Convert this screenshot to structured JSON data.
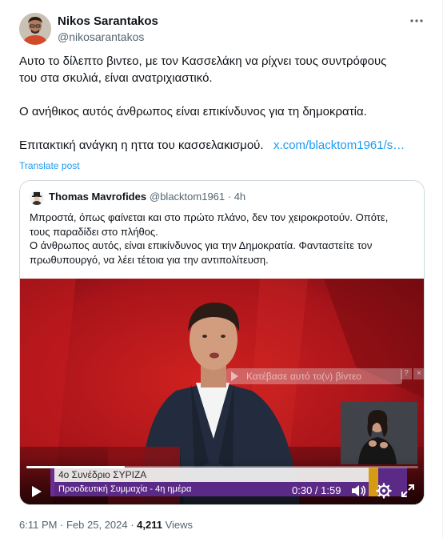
{
  "author": {
    "name": "Nikos Sarantakos",
    "handle": "@nikosarantakos",
    "avatar_icon": "user-photo"
  },
  "tweet": {
    "line1": "Αυτο το δίλεπτο βιντεο, με τον Κασσελάκη να ρίχνει τους συντρόφους",
    "line2": "του στα σκυλιά, είναι ανατριχιαστικό.",
    "line3": "Ο ανήθικος αυτός άνθρωπος είναι επικίνδυνος για τη δημοκρατία.",
    "line4": "Επιτακτική ανάγκη η ηττα του κασσελακισμού.",
    "link": "x.com/blacktom1961/s…",
    "translate_label": "Translate post"
  },
  "quote": {
    "name": "Thomas Mavrofides",
    "handle": "@blacktom1961 · 4h",
    "avatar_icon": "hat-avatar",
    "line1": "Μπροστά, όπως φαίνεται και στο πρώτο πλάνο, δεν τον χειροκροτούν. Οπότε,",
    "line2": "τους παραδίδει στο πλήθος.",
    "line3": "Ο άνθρωπος αυτός, είναι επικίνδυνος για την Δημοκρατία. Φανταστείτε τον",
    "line4": "πρωθυπουργό, να λέει τέτοια για την αντιπολίτευση."
  },
  "video": {
    "ad_overlay_text": "Κατέβασε αυτό το(ν) βίντεο",
    "ad_help": "?",
    "ad_close": "×",
    "lower_third_title": "4ο Συνέδριο ΣΥΡΙΖΑ",
    "lower_third_sub": "Προοδευτική Συμμαχία - 4η ημέρα",
    "time_display": "0:30 / 1:59",
    "progress_fraction": 0.252,
    "icons": [
      "play-icon",
      "volume-icon",
      "gear-icon",
      "fullscreen-icon"
    ],
    "colors": {
      "background_red": "#b3141a",
      "lower_third_purple": "#5b2a87",
      "accent_gold": "#d59b13"
    }
  },
  "meta": {
    "timestamp": "6:11 PM · Feb 25, 2024 · ",
    "views_count": "4,211",
    "views_label": " Views"
  },
  "colors": {
    "link": "#1d9bf0",
    "secondary_text": "#536471",
    "border": "#cfd9de"
  }
}
